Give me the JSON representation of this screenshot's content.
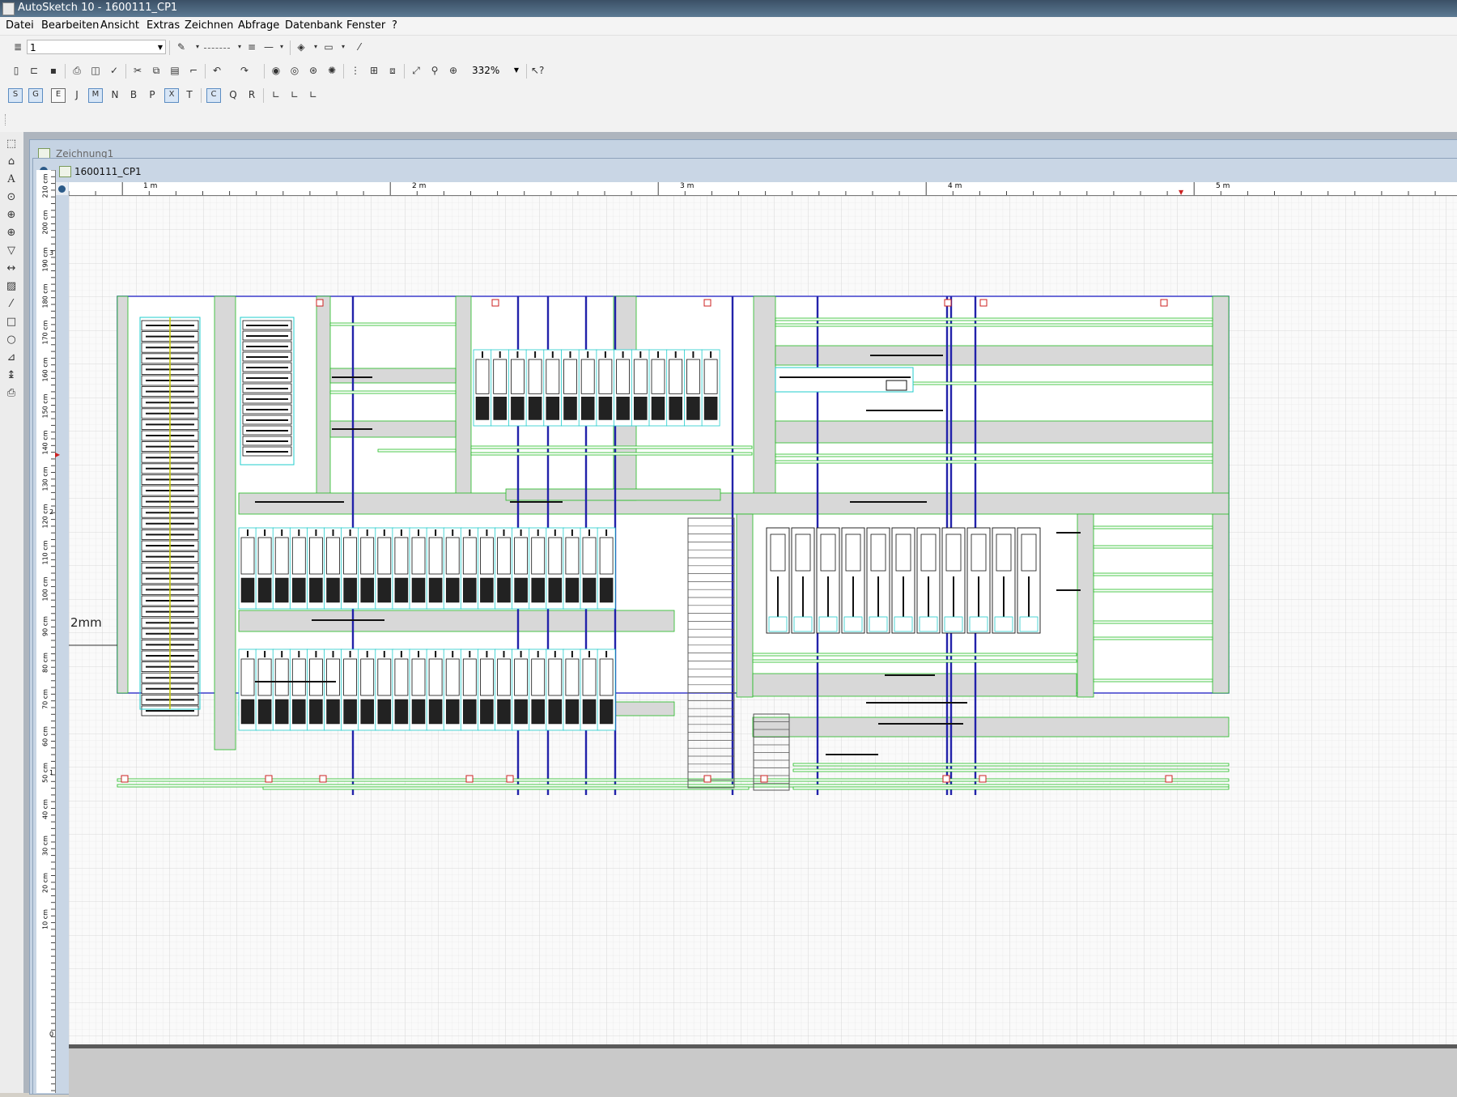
{
  "window": {
    "title": "AutoSketch 10 - 1600111_CP1"
  },
  "menu": [
    "Datei",
    "Bearbeiten",
    "Ansicht",
    "Extras",
    "Zeichnen",
    "Abfrage",
    "Datenbank",
    "Fenster",
    "?"
  ],
  "toolbar": {
    "layer_value": "1",
    "zoom_value": "332%"
  },
  "documents": {
    "back_title": "Zeichnung1",
    "front_title": "1600111_CP1"
  },
  "rulers": {
    "top_labels": [
      "1 m",
      "2 m",
      "3 m",
      "4 m",
      "5 m"
    ],
    "left_labels": [
      "210 cm",
      "200 cm",
      "190 cm",
      "180 cm",
      "170 cm",
      "160 cm",
      "150 cm",
      "140 cm",
      "130 cm",
      "120 cm",
      "110 cm",
      "100 cm",
      "90 cm",
      "80 cm",
      "70 cm",
      "60 cm",
      "50 cm",
      "40 cm",
      "30 cm",
      "20 cm",
      "10 cm"
    ],
    "left_meter_labels": [
      "3",
      "2",
      "1",
      "0"
    ]
  },
  "drawing": {
    "dimension_label": "2mm"
  },
  "colors": {
    "frame": "#3c3ccc",
    "rail": "#22bb22",
    "duct": "#d8d8d8",
    "module_outline": "#22cccc",
    "blue_bar": "#2222aa",
    "terminal_red": "#cc2222"
  },
  "icons": {
    "tools_left": [
      "select-icon",
      "text-icon",
      "zoom-window-icon",
      "zoom-all-icon",
      "zoom-in-icon",
      "fill-icon",
      "dimension-icon",
      "hatch-icon",
      "line-icon",
      "rectangle-icon",
      "circle-icon",
      "ortho-icon",
      "snap-icon",
      "print-icon"
    ]
  }
}
